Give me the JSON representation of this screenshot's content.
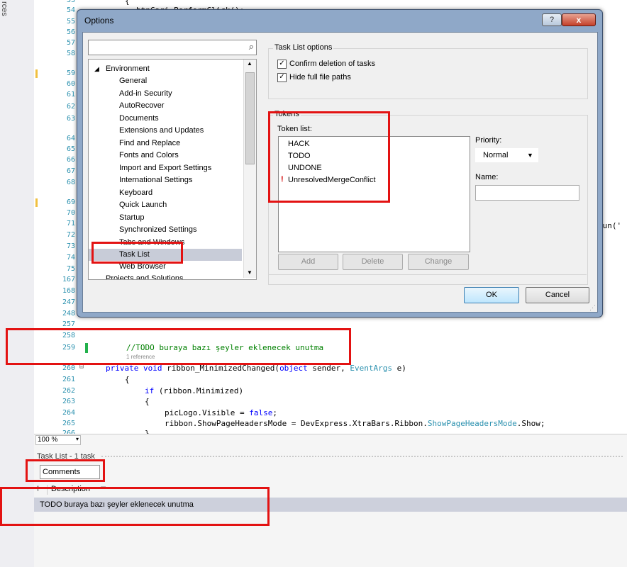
{
  "side_tab": "rces",
  "editor": {
    "lines": [
      {
        "num": "53",
        "code": "{"
      },
      {
        "num": "54",
        "code": "btnCari.PerformClick();"
      },
      {
        "num": "55"
      },
      {
        "num": "56"
      },
      {
        "num": "57"
      },
      {
        "num": "58"
      },
      {
        "num": "59"
      },
      {
        "num": "60"
      },
      {
        "num": "61"
      },
      {
        "num": "62"
      },
      {
        "num": "63"
      },
      {
        "num": "64"
      },
      {
        "num": "65"
      },
      {
        "num": "66"
      },
      {
        "num": "67"
      },
      {
        "num": "68"
      },
      {
        "num": "69"
      },
      {
        "num": "70"
      },
      {
        "num": "71"
      },
      {
        "num": "72"
      },
      {
        "num": "73"
      },
      {
        "num": "74"
      },
      {
        "num": "75"
      },
      {
        "num": "167"
      },
      {
        "num": "168"
      },
      {
        "num": "247"
      },
      {
        "num": "248"
      },
      {
        "num": "257"
      },
      {
        "num": "258"
      },
      {
        "num": "259",
        "code": "//TODO buraya bazı şeyler eklenecek unutma"
      },
      {
        "num": "260",
        "code_kw1": "private void",
        "code_mid": " ribbon_MinimizedChanged(",
        "code_kw2": "object",
        "code_mid2": " sender, ",
        "code_ty": "EventArgs",
        "code_end": " e)"
      },
      {
        "num": "261",
        "code": "{"
      },
      {
        "num": "262",
        "code_kw": "if",
        "code_rest": " (ribbon.Minimized)"
      },
      {
        "num": "263",
        "code": "{"
      },
      {
        "num": "264",
        "code_pre": "picLogo.Visible = ",
        "code_kw": "false",
        "code_post": ";"
      },
      {
        "num": "265",
        "code_pre": "ribbon.ShowPageHeadersMode = DevExpress.XtraBars.Ribbon.",
        "code_ty": "ShowPageHeadersMode",
        "code_post": ".Show;"
      },
      {
        "num": "266",
        "code": "}"
      }
    ],
    "reference_hint": "1 reference",
    "partial_right": "tun('",
    "zoom": "100 %"
  },
  "task_list": {
    "title": "Task List - 1 task",
    "filter": "Comments",
    "col_marker": "!",
    "col_description": "Description",
    "row_description": "TODO buraya bazı şeyler eklenecek unutma"
  },
  "dialog": {
    "title": "Options",
    "help": "?",
    "close": "x",
    "search_placeholder": "",
    "tree": {
      "root": "Environment",
      "items": [
        "General",
        "Add-in Security",
        "AutoRecover",
        "Documents",
        "Extensions and Updates",
        "Find and Replace",
        "Fonts and Colors",
        "Import and Export Settings",
        "International Settings",
        "Keyboard",
        "Quick Launch",
        "Startup",
        "Synchronized Settings",
        "Tabs and Windows",
        "Task List",
        "Web Browser"
      ],
      "selected": "Task List",
      "cut_off": "Projects and Solutions"
    },
    "task_list_options": {
      "group_label": "Task List options",
      "confirm_deletion": "Confirm deletion of tasks",
      "hide_paths": "Hide full file paths"
    },
    "tokens": {
      "group_label": "Tokens",
      "list_label": "Token list:",
      "items": [
        "HACK",
        "TODO",
        "UNDONE",
        "UnresolvedMergeConflict"
      ],
      "priority_label": "Priority:",
      "priority_value": "Normal",
      "name_label": "Name:",
      "name_value": "",
      "add": "Add",
      "delete": "Delete",
      "change": "Change"
    },
    "ok": "OK",
    "cancel": "Cancel"
  },
  "colors": {
    "highlight": "#e31212",
    "line_numbers": "#2b91af",
    "keyword": "#0000ff",
    "comment": "#008000"
  }
}
